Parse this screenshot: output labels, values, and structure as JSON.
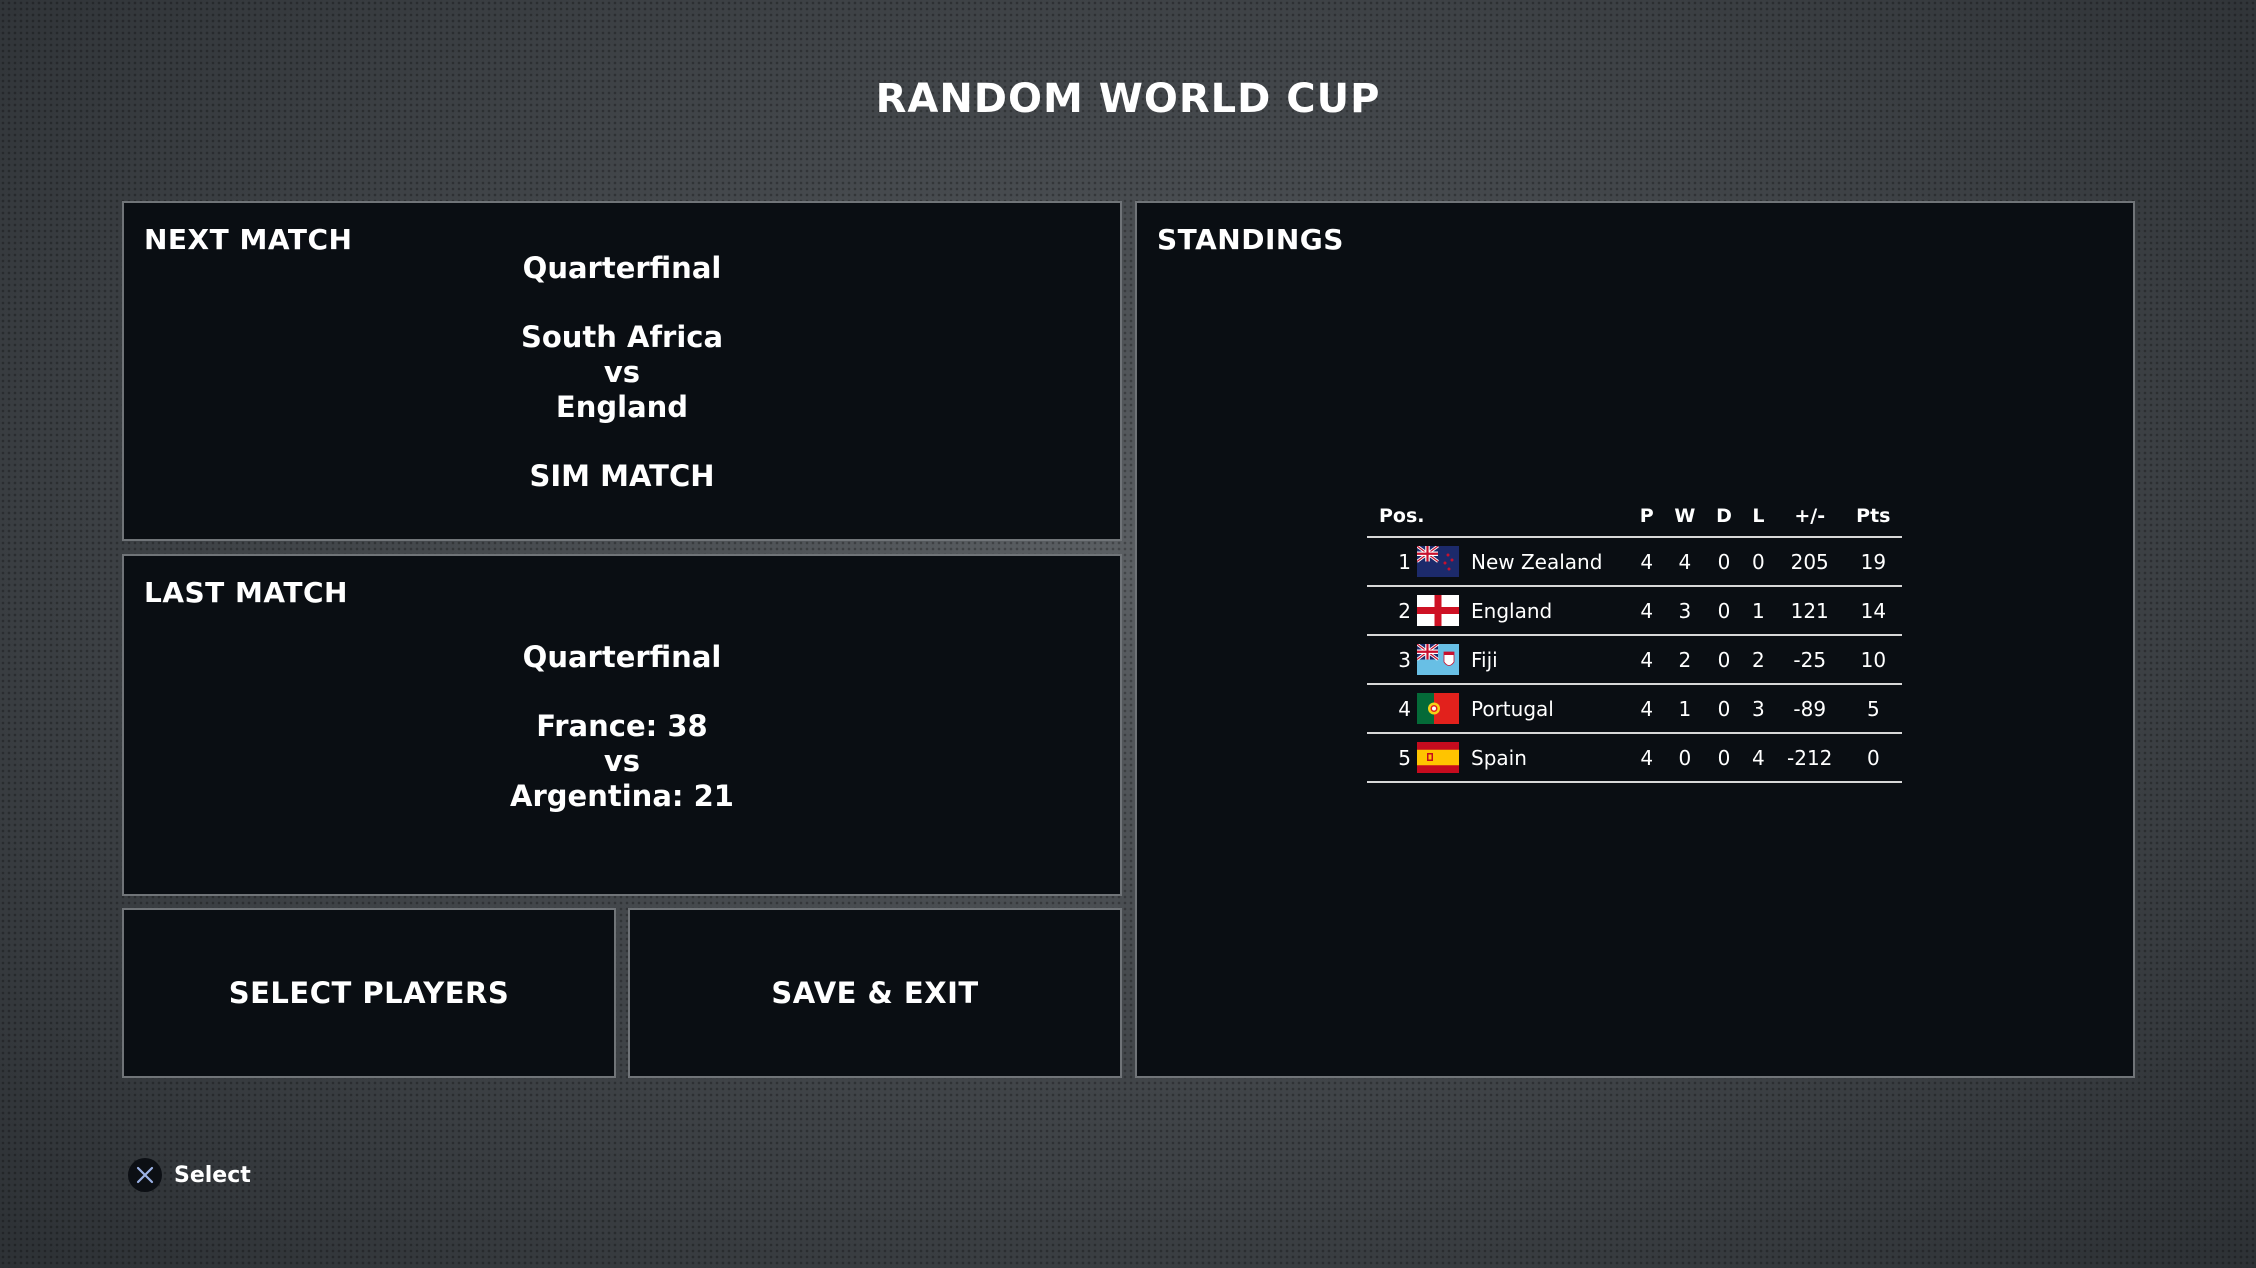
{
  "title": "RANDOM WORLD CUP",
  "next_match": {
    "heading": "NEXT MATCH",
    "round": "Quarterfinal",
    "home": "South Africa",
    "vs": "vs",
    "away": "England",
    "action": "SIM MATCH"
  },
  "last_match": {
    "heading": "LAST MATCH",
    "round": "Quarterfinal",
    "home": "France: 38",
    "vs": "vs",
    "away": "Argentina: 21"
  },
  "buttons": {
    "select_players": "SELECT PLAYERS",
    "save_exit": "SAVE & EXIT"
  },
  "standings": {
    "heading": "STANDINGS",
    "columns": [
      "Pos.",
      "P",
      "W",
      "D",
      "L",
      "+/-",
      "Pts"
    ],
    "rows": [
      {
        "pos": "1",
        "team": "New Zealand",
        "flag": "new-zealand-flag-icon",
        "p": "4",
        "w": "4",
        "d": "0",
        "l": "0",
        "diff": "205",
        "pts": "19"
      },
      {
        "pos": "2",
        "team": "England",
        "flag": "england-flag-icon",
        "p": "4",
        "w": "3",
        "d": "0",
        "l": "1",
        "diff": "121",
        "pts": "14"
      },
      {
        "pos": "3",
        "team": "Fiji",
        "flag": "fiji-flag-icon",
        "p": "4",
        "w": "2",
        "d": "0",
        "l": "2",
        "diff": "-25",
        "pts": "10"
      },
      {
        "pos": "4",
        "team": "Portugal",
        "flag": "portugal-flag-icon",
        "p": "4",
        "w": "1",
        "d": "0",
        "l": "3",
        "diff": "-89",
        "pts": "5"
      },
      {
        "pos": "5",
        "team": "Spain",
        "flag": "spain-flag-icon",
        "p": "4",
        "w": "0",
        "d": "0",
        "l": "4",
        "diff": "-212",
        "pts": "0"
      }
    ]
  },
  "footer": {
    "button_icon": "cross-button-icon",
    "label": "Select"
  },
  "colors": {
    "panel_bg": "#0a0e13",
    "panel_border": "#707478",
    "text": "#ffffff",
    "row_line": "#d8d8d8"
  }
}
